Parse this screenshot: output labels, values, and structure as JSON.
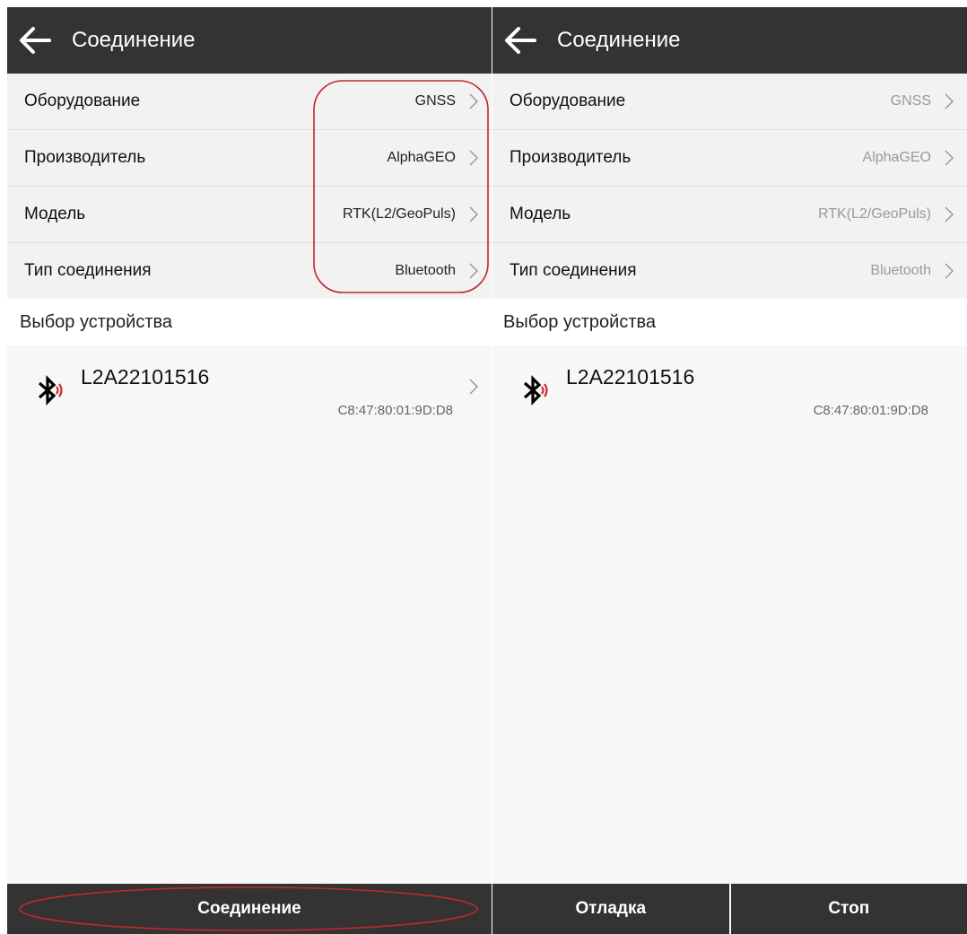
{
  "left": {
    "header": {
      "title": "Соединение"
    },
    "settings": [
      {
        "label": "Оборудование",
        "value": "GNSS"
      },
      {
        "label": "Производитель",
        "value": "AlphaGEO"
      },
      {
        "label": "Модель",
        "value": "RTK(L2/GeoPuls)"
      },
      {
        "label": "Тип соединения",
        "value": "Bluetooth"
      }
    ],
    "section_title": "Выбор устройства",
    "device": {
      "name": "L2A22101516",
      "mac": "C8:47:80:01:9D:D8"
    },
    "buttons": {
      "connect": "Соединение"
    }
  },
  "right": {
    "header": {
      "title": "Соединение"
    },
    "settings": [
      {
        "label": "Оборудование",
        "value": "GNSS"
      },
      {
        "label": "Производитель",
        "value": "AlphaGEO"
      },
      {
        "label": "Модель",
        "value": "RTK(L2/GeoPuls)"
      },
      {
        "label": "Тип соединения",
        "value": "Bluetooth"
      }
    ],
    "section_title": "Выбор устройства",
    "device": {
      "name": "L2A22101516",
      "mac": "C8:47:80:01:9D:D8"
    },
    "buttons": {
      "debug": "Отладка",
      "stop": "Стоп"
    }
  },
  "colors": {
    "appbar": "#333333",
    "annotation": "#c0282e",
    "bluetooth_signal": "#d0282e",
    "disabled_value": "#9a9a9a"
  }
}
